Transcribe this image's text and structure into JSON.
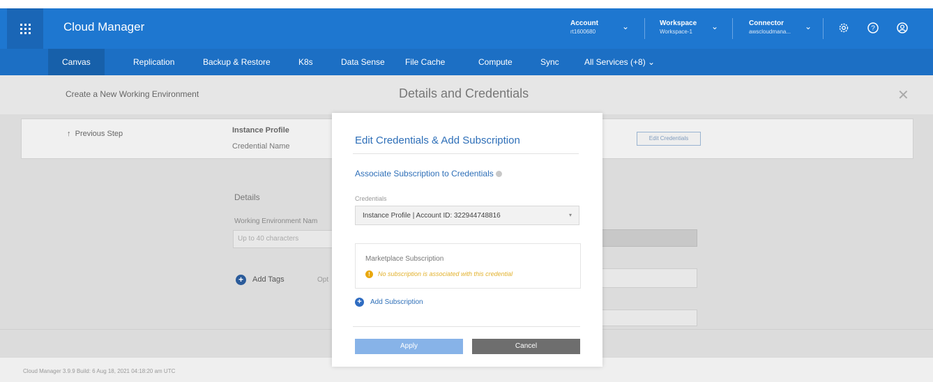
{
  "header": {
    "app_title": "Cloud Manager",
    "grid_icon": "app-grid-icon",
    "account": {
      "label": "Account",
      "value": "rt1600680"
    },
    "workspace": {
      "label": "Workspace",
      "value": "Workspace-1"
    },
    "connector": {
      "label": "Connector",
      "value": "awscloudmana..."
    },
    "icons": [
      "gear-icon",
      "help-icon",
      "user-icon"
    ],
    "bg_color": "#1e77d0"
  },
  "nav": {
    "items": [
      {
        "label": "Canvas",
        "active": true
      },
      {
        "label": "Replication"
      },
      {
        "label": "Backup & Restore"
      },
      {
        "label": "K8s"
      },
      {
        "label": "Data Sense"
      },
      {
        "label": "File Cache"
      },
      {
        "label": "Compute"
      },
      {
        "label": "Sync"
      },
      {
        "label": "All Services (+8) ⌄"
      }
    ]
  },
  "page": {
    "breadcrumb": "Create a New Working Environment",
    "title": "Details and Credentials",
    "close": "✕",
    "previous_step": "Previous Step",
    "instance_profile_label": "Instance Profile",
    "credential_name_label": "Credential Name",
    "edit_credentials_button": "Edit Credentials",
    "details_title": "Details",
    "working_env_name_label": "Working Environment Nam",
    "working_env_name_placeholder": "Up to 40 characters",
    "add_tags": "Add Tags",
    "optional_label": "Opt"
  },
  "modal": {
    "title": "Edit Credentials & Add Subscription",
    "subtitle": "Associate Subscription to Credentials",
    "credentials_label": "Credentials",
    "credentials_value": "Instance Profile | Account ID: 322944748816",
    "marketplace_label": "Marketplace Subscription",
    "warning_text": "No subscription is associated with this credential",
    "add_subscription": "Add Subscription",
    "apply": "Apply",
    "cancel": "Cancel",
    "accent_color": "#2e6fb8",
    "warning_color": "#e9a80e"
  },
  "footer": {
    "text": "Cloud Manager 3.9.9   Build: 6   Aug 18, 2021 04:18:20 am UTC"
  }
}
